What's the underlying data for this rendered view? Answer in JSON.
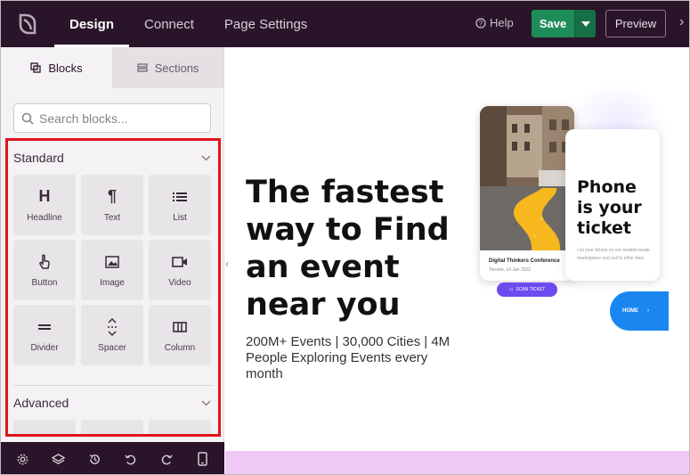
{
  "topbar": {
    "tabs": [
      {
        "label": "Design"
      },
      {
        "label": "Connect"
      },
      {
        "label": "Page Settings"
      }
    ],
    "help_label": "Help",
    "save_label": "Save",
    "preview_label": "Preview"
  },
  "sidebar": {
    "tabs": [
      {
        "label": "Blocks"
      },
      {
        "label": "Sections"
      }
    ],
    "search_placeholder": "Search blocks...",
    "standard_title": "Standard",
    "advanced_title": "Advanced",
    "blocks": [
      {
        "label": "Headline",
        "icon": "H"
      },
      {
        "label": "Text",
        "icon": "¶"
      },
      {
        "label": "List",
        "icon": "list-icon"
      },
      {
        "label": "Button",
        "icon": "pointer-icon"
      },
      {
        "label": "Image",
        "icon": "image-icon"
      },
      {
        "label": "Video",
        "icon": "video-icon"
      },
      {
        "label": "Divider",
        "icon": "divider-icon"
      },
      {
        "label": "Spacer",
        "icon": "spacer-icon"
      },
      {
        "label": "Column",
        "icon": "column-icon"
      }
    ]
  },
  "canvas": {
    "headline": "The fastest way to Find an event near you",
    "subtext": "200M+ Events | 30,000 Cities | 4M People Exploring Events every month",
    "phone1": {
      "event_title": "Digital Thinkers Conference",
      "event_location": "Toronto, 14 Jan 2022",
      "scan_label": "SCAN TICKET"
    },
    "phone2": {
      "title": "Phone is your ticket",
      "description": "List your tickets on our trusted resale marketplace and sell to other fans"
    },
    "home_label": "HOME"
  },
  "colors": {
    "topbar": "#2a1429",
    "save": "#1e8c59",
    "highlight_border": "#e1151b",
    "scan_button": "#6c4cf0",
    "home_blob": "#1a87f0",
    "footer_strip": "#efc8f5"
  }
}
